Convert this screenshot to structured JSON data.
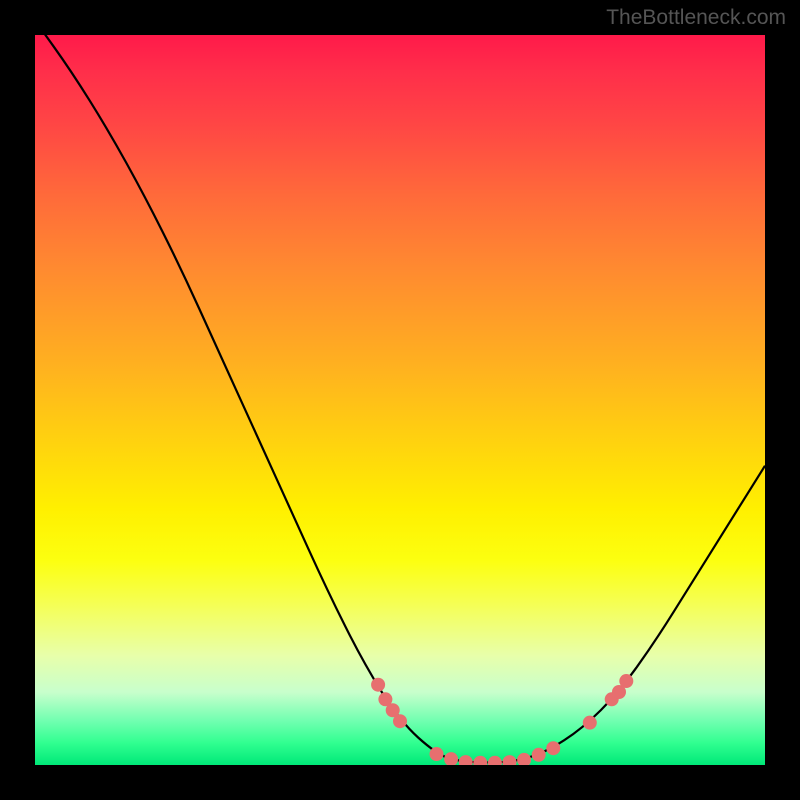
{
  "attribution": "TheBottleneck.com",
  "chart_data": {
    "type": "line",
    "title": "",
    "xlabel": "",
    "ylabel": "",
    "xlim": [
      0,
      100
    ],
    "ylim": [
      0,
      100
    ],
    "curve": [
      {
        "x": 0,
        "y": 102
      },
      {
        "x": 5,
        "y": 95
      },
      {
        "x": 10,
        "y": 87
      },
      {
        "x": 15,
        "y": 78
      },
      {
        "x": 20,
        "y": 68
      },
      {
        "x": 25,
        "y": 57
      },
      {
        "x": 30,
        "y": 46
      },
      {
        "x": 35,
        "y": 35
      },
      {
        "x": 40,
        "y": 24
      },
      {
        "x": 45,
        "y": 14
      },
      {
        "x": 50,
        "y": 6
      },
      {
        "x": 55,
        "y": 1.5
      },
      {
        "x": 58,
        "y": 0.5
      },
      {
        "x": 62,
        "y": 0.3
      },
      {
        "x": 66,
        "y": 0.5
      },
      {
        "x": 70,
        "y": 1.8
      },
      {
        "x": 75,
        "y": 5
      },
      {
        "x": 80,
        "y": 10
      },
      {
        "x": 85,
        "y": 17
      },
      {
        "x": 90,
        "y": 25
      },
      {
        "x": 95,
        "y": 33
      },
      {
        "x": 100,
        "y": 41
      }
    ],
    "markers": [
      {
        "x": 47,
        "y": 11
      },
      {
        "x": 48,
        "y": 9
      },
      {
        "x": 49,
        "y": 7.5
      },
      {
        "x": 50,
        "y": 6
      },
      {
        "x": 55,
        "y": 1.5
      },
      {
        "x": 57,
        "y": 0.8
      },
      {
        "x": 59,
        "y": 0.4
      },
      {
        "x": 61,
        "y": 0.3
      },
      {
        "x": 63,
        "y": 0.3
      },
      {
        "x": 65,
        "y": 0.4
      },
      {
        "x": 67,
        "y": 0.7
      },
      {
        "x": 69,
        "y": 1.4
      },
      {
        "x": 71,
        "y": 2.3
      },
      {
        "x": 76,
        "y": 5.8
      },
      {
        "x": 79,
        "y": 9
      },
      {
        "x": 80,
        "y": 10
      },
      {
        "x": 81,
        "y": 11.5
      }
    ],
    "marker_color": "#e76f6f",
    "curve_color": "#000000"
  }
}
